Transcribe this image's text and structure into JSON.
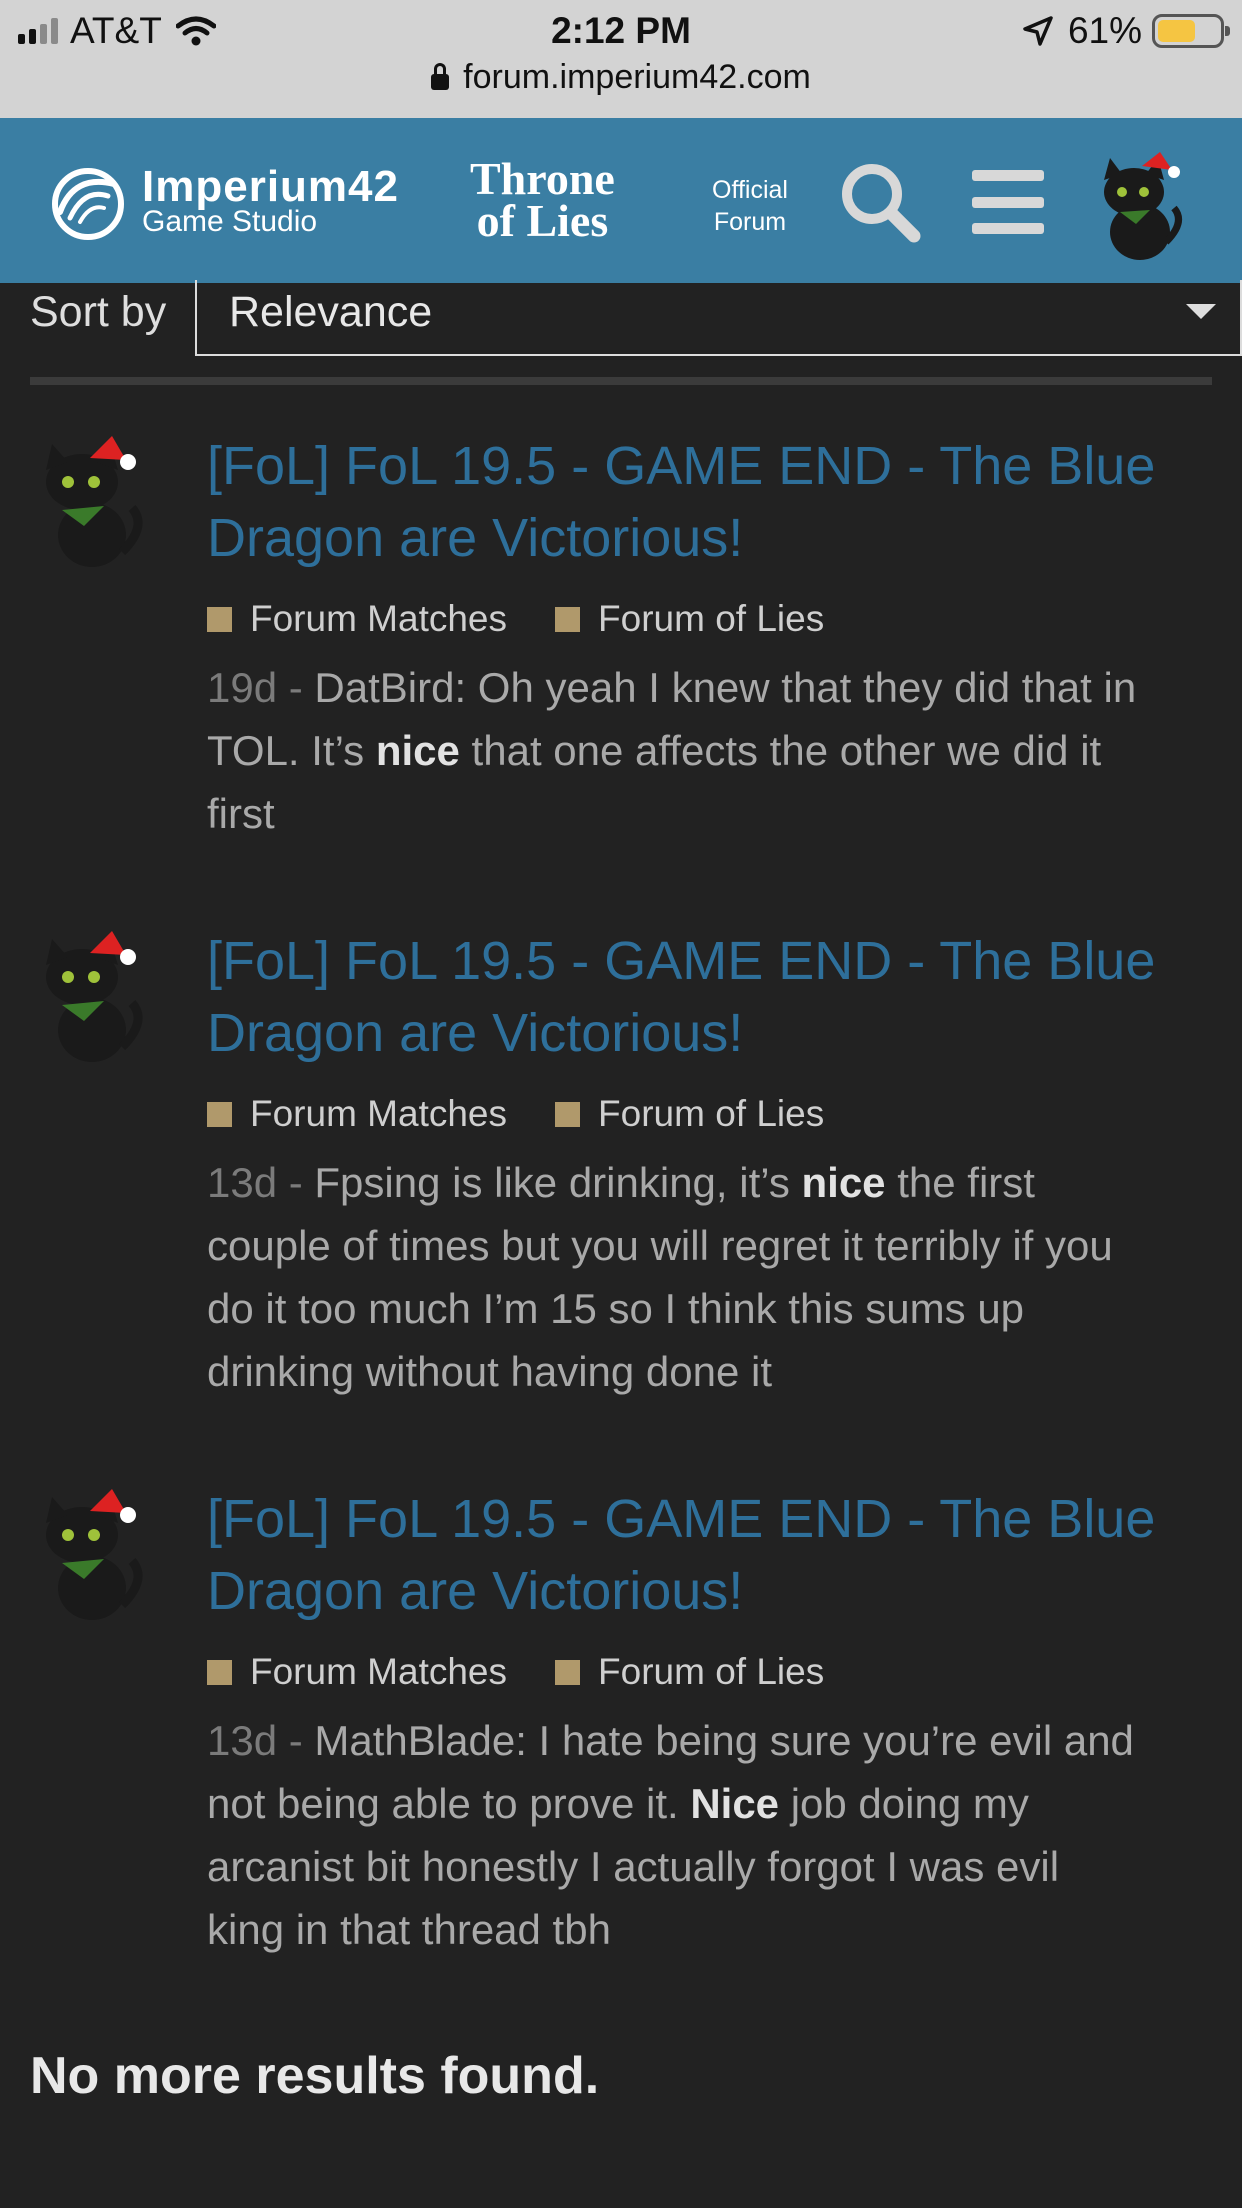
{
  "status_bar": {
    "carrier": "AT&T",
    "time": "2:12 PM",
    "battery_percent": "61%",
    "battery_level": 0.61,
    "url": "forum.imperium42.com"
  },
  "header": {
    "studio_name": "Imperium42",
    "studio_sub": "Game Studio",
    "game_line1": "Throne",
    "game_line2": "of Lies",
    "official_line1": "Official",
    "official_line2": "Forum"
  },
  "sort": {
    "label": "Sort by",
    "value": "Relevance"
  },
  "results": [
    {
      "title": "[FoL] FoL 19.5 - GAME END - The Blue Dragon are Victorious!",
      "categories": [
        "Forum Matches",
        "Forum of Lies"
      ],
      "age": "19d",
      "sep": " - ",
      "before": "DatBird: Oh yeah I knew that they did that in TOL. It’s ",
      "highlight": "nice",
      "after": " that one affects the other we did it first"
    },
    {
      "title": "[FoL] FoL 19.5 - GAME END - The Blue Dragon are Victorious!",
      "categories": [
        "Forum Matches",
        "Forum of Lies"
      ],
      "age": "13d",
      "sep": " - ",
      "before": "Fpsing is like drinking, it’s ",
      "highlight": "nice",
      "after": " the first couple of times but you will regret it terribly if you do it too much I’m 15 so I think this sums up drinking without having done it"
    },
    {
      "title": "[FoL] FoL 19.5 - GAME END - The Blue Dragon are Victorious!",
      "categories": [
        "Forum Matches",
        "Forum of Lies"
      ],
      "age": "13d",
      "sep": " - ",
      "before": "MathBlade: I hate being sure you’re evil and not being able to prove it. ",
      "highlight": "Nice",
      "after": " job doing my arcanist bit honestly I actually forgot I was evil king in that thread tbh"
    }
  ],
  "footer": {
    "no_more": "No more results found."
  },
  "colors": {
    "header_bg": "#3a7ea3",
    "page_bg": "#222222",
    "title_link": "#2e6f9a",
    "category_square": "#b0996b",
    "battery_fill": "#f5c542"
  }
}
